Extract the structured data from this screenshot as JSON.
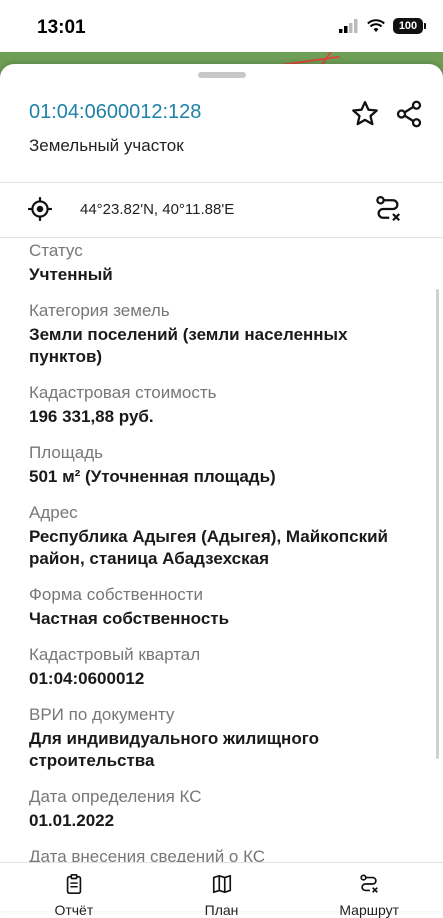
{
  "status_bar": {
    "time": "13:01",
    "battery": "100"
  },
  "header": {
    "cadastral_number": "01:04:0600012:128",
    "object_type": "Земельный участок"
  },
  "coordinates": "44°23.82'N, 40°11.88'E",
  "details": [
    {
      "label": "Статус",
      "value": "Учтенный"
    },
    {
      "label": "Категория земель",
      "value": "Земли поселений (земли населенных пунктов)"
    },
    {
      "label": "Кадастровая стоимость",
      "value": "196 331,88 руб."
    },
    {
      "label": "Площадь",
      "value": "501 м² (Уточненная площадь)"
    },
    {
      "label": "Адрес",
      "value": "Республика Адыгея (Адыгея), Майкопский район, станица Абадзехская"
    },
    {
      "label": "Форма собственности",
      "value": "Частная собственность"
    },
    {
      "label": "Кадастровый квартал",
      "value": "01:04:0600012"
    },
    {
      "label": "ВРИ по документу",
      "value": "Для индивидуального жилищного строительства"
    },
    {
      "label": "Дата определения КС",
      "value": "01.01.2022"
    },
    {
      "label": "Дата внесения сведений о КС",
      "value": ""
    }
  ],
  "tabs": [
    {
      "label": "Отчёт",
      "icon": "report-icon"
    },
    {
      "label": "План",
      "icon": "map-icon"
    },
    {
      "label": "Маршрут",
      "icon": "route-icon"
    }
  ],
  "colors": {
    "accent": "#1f82a8",
    "map": "#6f9e57"
  }
}
